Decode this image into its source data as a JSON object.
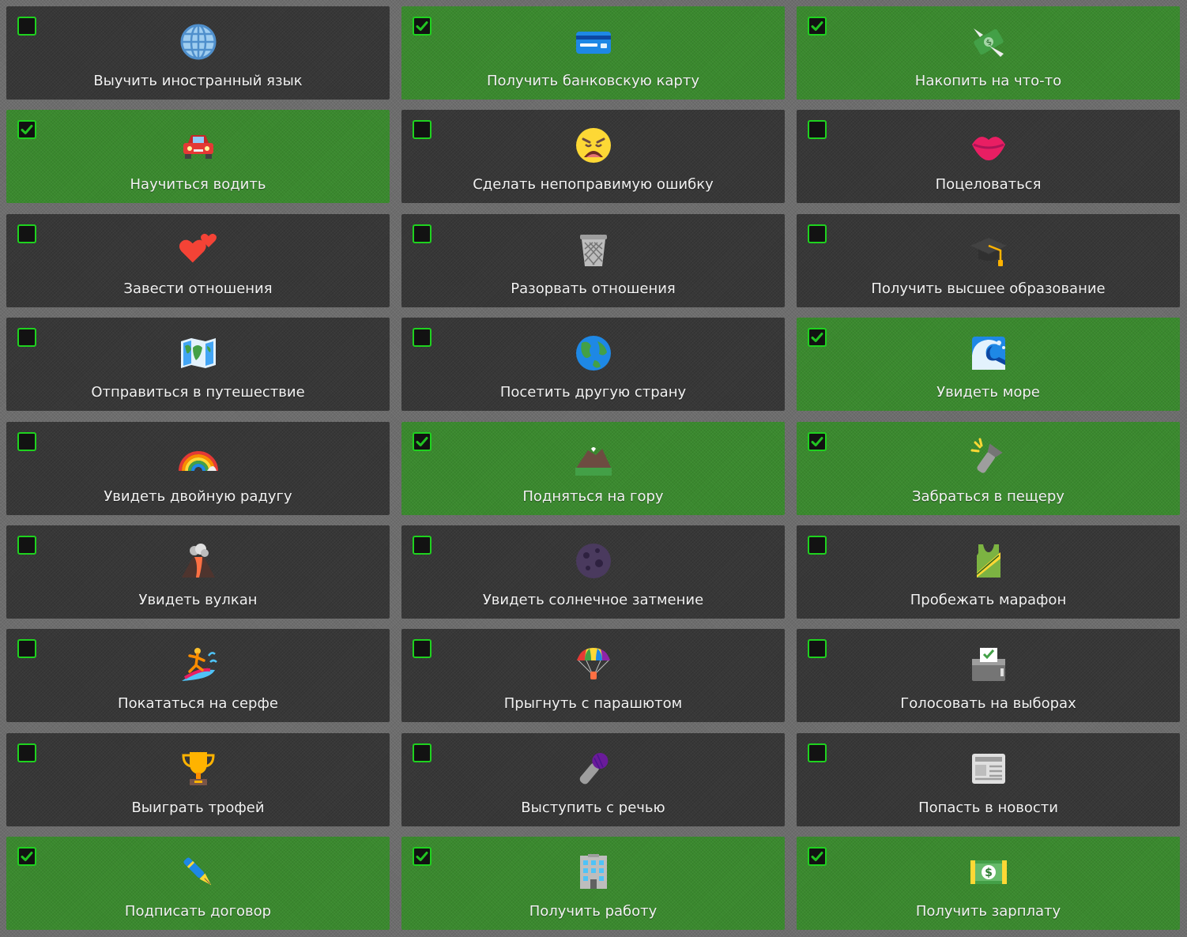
{
  "items": [
    {
      "label": "Выучить иностранный язык",
      "done": false,
      "icon": "globe-icon"
    },
    {
      "label": "Получить банковскую карту",
      "done": true,
      "icon": "credit-card-icon"
    },
    {
      "label": "Накопить на что-то",
      "done": true,
      "icon": "money-with-wings-icon"
    },
    {
      "label": "Научиться водить",
      "done": true,
      "icon": "car-icon"
    },
    {
      "label": "Сделать непоправимую ошибку",
      "done": false,
      "icon": "weary-face-icon"
    },
    {
      "label": "Поцеловаться",
      "done": false,
      "icon": "kiss-lips-icon"
    },
    {
      "label": "Завести отношения",
      "done": false,
      "icon": "two-hearts-icon"
    },
    {
      "label": "Разорвать отношения",
      "done": false,
      "icon": "wastebasket-icon"
    },
    {
      "label": "Получить высшее образование",
      "done": false,
      "icon": "graduation-cap-icon"
    },
    {
      "label": "Отправиться в путешествие",
      "done": false,
      "icon": "world-map-icon"
    },
    {
      "label": "Посетить другую страну",
      "done": false,
      "icon": "earth-globe-icon"
    },
    {
      "label": "Увидеть море",
      "done": true,
      "icon": "water-wave-icon"
    },
    {
      "label": "Увидеть двойную радугу",
      "done": false,
      "icon": "rainbow-icon"
    },
    {
      "label": "Подняться на гору",
      "done": true,
      "icon": "mountain-icon"
    },
    {
      "label": "Забраться в пещеру",
      "done": true,
      "icon": "flashlight-icon"
    },
    {
      "label": "Увидеть вулкан",
      "done": false,
      "icon": "volcano-icon"
    },
    {
      "label": "Увидеть солнечное затмение",
      "done": false,
      "icon": "new-moon-icon"
    },
    {
      "label": "Пробежать марафон",
      "done": false,
      "icon": "running-shirt-icon"
    },
    {
      "label": "Покататься на серфе",
      "done": false,
      "icon": "surfer-icon"
    },
    {
      "label": "Прыгнуть с парашютом",
      "done": false,
      "icon": "parachute-icon"
    },
    {
      "label": "Голосовать на выборах",
      "done": false,
      "icon": "ballot-box-icon"
    },
    {
      "label": "Выиграть трофей",
      "done": false,
      "icon": "trophy-icon"
    },
    {
      "label": "Выступить с речью",
      "done": false,
      "icon": "microphone-icon"
    },
    {
      "label": "Попасть в новости",
      "done": false,
      "icon": "newspaper-icon"
    },
    {
      "label": "Подписать договор",
      "done": true,
      "icon": "fountain-pen-icon"
    },
    {
      "label": "Получить работу",
      "done": true,
      "icon": "office-building-icon"
    },
    {
      "label": "Получить зарплату",
      "done": true,
      "icon": "dollar-banknote-icon"
    }
  ],
  "colors": {
    "done": "#3a8a2e",
    "pending": "#383838",
    "checkbox_border": "#1fd21f",
    "text": "#f2f2f2"
  }
}
